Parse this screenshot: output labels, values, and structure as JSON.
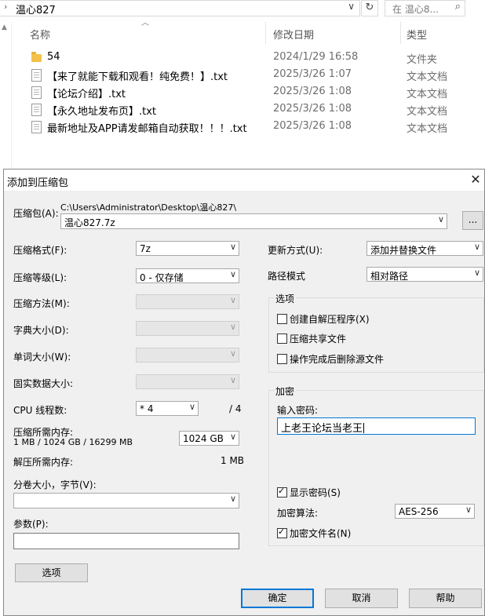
{
  "explorer": {
    "address_chevron": "›",
    "address_path": "温心827",
    "address_dropdown": "∨",
    "refresh_icon": "↻",
    "search_placeholder": "在 温心8...",
    "search_icon": "⌕",
    "columns": {
      "name": "名称",
      "modified": "修改日期",
      "type": "类型"
    },
    "rows": [
      {
        "kind": "folder",
        "name": "54",
        "date": "2024/1/29 16:58",
        "type": "文件夹"
      },
      {
        "kind": "doc",
        "name": "【来了就能下载和观看！纯免费！】.txt",
        "date": "2025/3/26 1:07",
        "type": "文本文档"
      },
      {
        "kind": "doc",
        "name": "【论坛介绍】.txt",
        "date": "2025/3/26 1:08",
        "type": "文本文档"
      },
      {
        "kind": "doc",
        "name": "【永久地址发布页】.txt",
        "date": "2025/3/26 1:08",
        "type": "文本文档"
      },
      {
        "kind": "doc",
        "name": "最新地址及APP请发邮箱自动获取！！！.txt",
        "date": "2025/3/26 1:08",
        "type": "文本文档"
      }
    ]
  },
  "dialog": {
    "title": "添加到压缩包",
    "close_icon": "✕",
    "archive_label": "压缩包(A):",
    "archive_dir": "C:\\Users\\Administrator\\Desktop\\温心827\\",
    "archive_name": "温心827.7z",
    "browse_label": "...",
    "format_label": "压缩格式(F):",
    "format_value": "7z",
    "level_label": "压缩等级(L):",
    "level_value": "0 - 仅存储",
    "method_label": "压缩方法(M):",
    "dict_label": "字典大小(D):",
    "word_label": "单词大小(W):",
    "solid_label": "固实数据大小:",
    "cpu_label": "CPU 线程数:",
    "cpu_value": "* 4",
    "cpu_total": "/ 4",
    "mem_label": "压缩所需内存:",
    "mem_detail": "1 MB / 1024 GB / 16299 MB",
    "mem_value": "1024 GB",
    "decomp_label": "解压所需内存:",
    "decomp_value": "1 MB",
    "split_label": "分卷大小，字节(V):",
    "split_value": "",
    "params_label": "参数(P):",
    "params_value": "",
    "options_button": "选项",
    "update_label": "更新方式(U):",
    "update_value": "添加并替换文件",
    "pathmode_label": "路径模式",
    "pathmode_value": "相对路径",
    "options_group": "选项",
    "opt_sfx": "创建自解压程序(X)",
    "opt_shared": "压缩共享文件",
    "opt_delete": "操作完成后删除源文件",
    "enc_group": "加密",
    "pwd_label": "输入密码:",
    "pwd_value": "上老王论坛当老王",
    "show_pwd": "显示密码(S)",
    "show_pwd_checked": true,
    "enc_method_label": "加密算法:",
    "enc_method_value": "AES-256",
    "enc_names": "加密文件名(N)",
    "enc_names_checked": true,
    "ok": "确定",
    "cancel": "取消",
    "help": "帮助",
    "dropdown_arrow": "∨",
    "check_mark": "✓"
  }
}
